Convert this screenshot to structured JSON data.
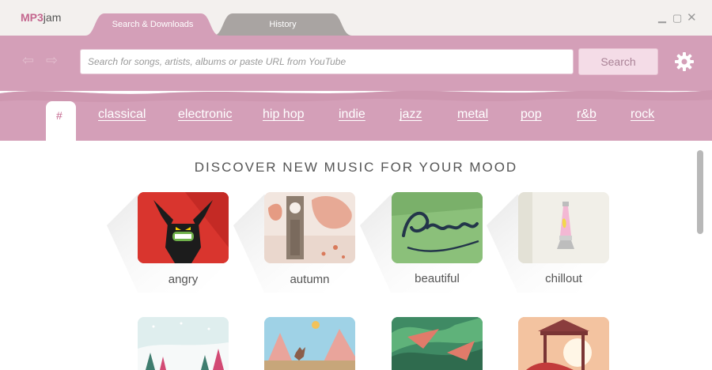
{
  "app": {
    "logo_mp3": "MP3",
    "logo_jam": "jam"
  },
  "tabs": [
    {
      "label": "Search & Downloads",
      "active": true
    },
    {
      "label": "History",
      "active": false
    }
  ],
  "window_controls": {
    "minimize": "▁",
    "maximize": "▢",
    "close": "✕"
  },
  "toolbar": {
    "back": "⇦",
    "forward": "⇨",
    "search_placeholder": "Search for songs, artists, albums or paste URL from YouTube",
    "search_value": "",
    "search_button": "Search",
    "settings_icon": "gear-icon"
  },
  "genres": {
    "active": "#",
    "items": [
      "classical",
      "electronic",
      "hip hop",
      "indie",
      "jazz",
      "metal",
      "pop",
      "r&b",
      "rock"
    ]
  },
  "main": {
    "heading": "DISCOVER NEW MUSIC FOR YOUR MOOD",
    "moods": [
      "angry",
      "autumn",
      "beautiful",
      "chillout"
    ]
  },
  "colors": {
    "accent": "#c4678f",
    "toolbar": "#d49fb8",
    "tab_active": "#d49fb8",
    "tab_inactive": "#a9a4a2",
    "titlebar": "#f3f0ee"
  }
}
